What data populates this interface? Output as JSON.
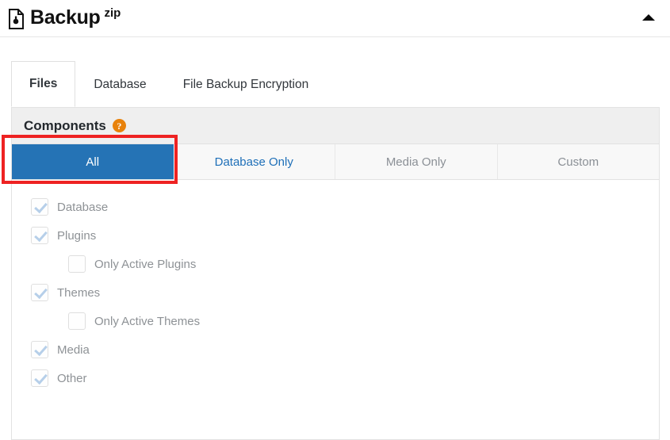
{
  "header": {
    "title": "Backup",
    "superscript": "zip",
    "icon": "document-lock-icon",
    "collapse_icon": "caret-up-icon"
  },
  "tabs": [
    {
      "label": "Files",
      "active": true,
      "name": "tab-files"
    },
    {
      "label": "Database",
      "active": false,
      "name": "tab-database"
    },
    {
      "label": "File Backup Encryption",
      "active": false,
      "name": "tab-file-backup-encryption"
    }
  ],
  "panel": {
    "title": "Components",
    "help_icon": "?",
    "segments": [
      {
        "label": "All",
        "state": "primary",
        "name": "segment-all",
        "highlighted": true
      },
      {
        "label": "Database Only",
        "state": "link",
        "name": "segment-database-only",
        "highlighted": false
      },
      {
        "label": "Media Only",
        "state": "muted",
        "name": "segment-media-only",
        "highlighted": false
      },
      {
        "label": "Custom",
        "state": "muted",
        "name": "segment-custom",
        "highlighted": false
      }
    ],
    "components": [
      {
        "label": "Database",
        "checked": true,
        "indented": false,
        "name": "checkbox-database"
      },
      {
        "label": "Plugins",
        "checked": true,
        "indented": false,
        "name": "checkbox-plugins"
      },
      {
        "label": "Only Active Plugins",
        "checked": false,
        "indented": true,
        "name": "checkbox-only-active-plugins"
      },
      {
        "label": "Themes",
        "checked": true,
        "indented": false,
        "name": "checkbox-themes"
      },
      {
        "label": "Only Active Themes",
        "checked": false,
        "indented": true,
        "name": "checkbox-only-active-themes"
      },
      {
        "label": "Media",
        "checked": true,
        "indented": false,
        "name": "checkbox-media"
      },
      {
        "label": "Other",
        "checked": true,
        "indented": false,
        "name": "checkbox-other"
      }
    ]
  },
  "colors": {
    "primary_blue": "#2573b5",
    "link_blue": "#1e6fb8",
    "highlight_red": "#ee2222",
    "help_orange": "#e8820c",
    "check_blue": "#b6cfe9",
    "header_gray": "#efefef"
  }
}
